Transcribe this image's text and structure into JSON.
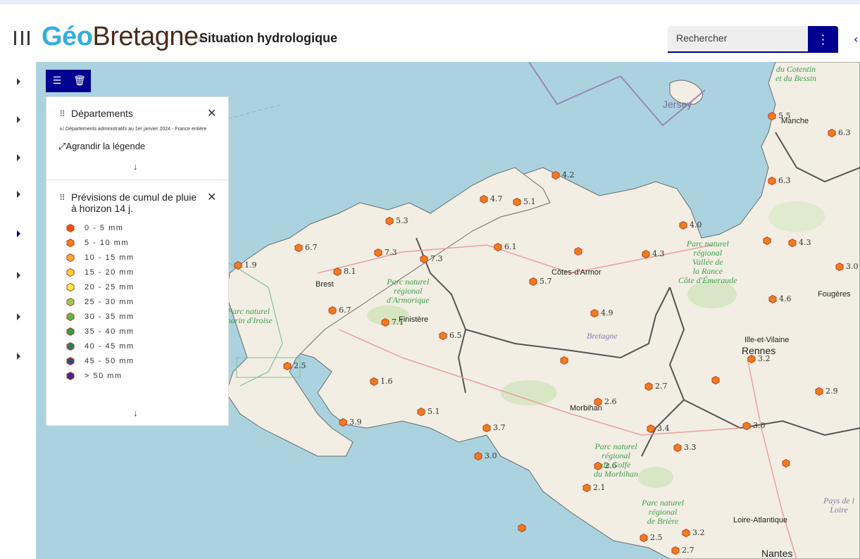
{
  "header": {
    "menu_icon": "hamburger-menu-icon",
    "logo_geo": "Géo",
    "logo_bretagne": "Bretagne",
    "logo_reg": "®",
    "app_title": "Situation hydrologique",
    "search_placeholder": "Rechercher",
    "search_menu_icon": "vertical-dots-icon"
  },
  "toolbar": {
    "legend_icon": "list-icon",
    "delete_icon": "trash-icon"
  },
  "legend": {
    "layer1": {
      "title": "Départements",
      "subtitle": "Départements administratifs au 1er janvier 2024 - France entière",
      "expand_label": "Agrandir la légende"
    },
    "layer2": {
      "title_line1": "Prévisions de cumul de pluie",
      "title_line2": "à horizon 14 j.",
      "classes": [
        {
          "label": "0 - 5 mm",
          "color": "#e8560f"
        },
        {
          "label": "5 - 10  mm",
          "color": "#f07d1a"
        },
        {
          "label": "10 - 15  mm",
          "color": "#f6a833"
        },
        {
          "label": "15 - 20  mm",
          "color": "#fbd33f"
        },
        {
          "label": "20 - 25  mm",
          "color": "#f3f04a"
        },
        {
          "label": "25 - 30  mm",
          "color": "#8fd14f"
        },
        {
          "label": "30 - 35  mm",
          "color": "#57b84b"
        },
        {
          "label": "35 - 40  mm",
          "color": "#2f9e4f"
        },
        {
          "label": "40 - 45  mm",
          "color": "#2d7d5e"
        },
        {
          "label": "45 - 50  mm",
          "color": "#2b4f7d"
        },
        {
          "label": "> 50 mm",
          "color": "#3d2a8c"
        }
      ]
    }
  },
  "map": {
    "places": {
      "jersey": "Jersey",
      "cotentin_line1": "du Cotentin",
      "cotentin_line2": "et du Bessin",
      "manche": "Manche",
      "brest": "Brest",
      "finistere": "Finistère",
      "cotes_darmor": "Côtes-d'Armor",
      "bretagne": "Bretagne",
      "morbihan": "Morbihan",
      "ille_et_vilaine": "Ille-et-Vilaine",
      "rennes": "Rennes",
      "fougeres": "Fougères",
      "loire_atlantique": "Loire-Atlantique",
      "nantes": "Nantes",
      "pays_de_loire_line1": "Pays de l",
      "pays_de_loire_line2": "Loire"
    },
    "parks": {
      "armorique": [
        "Parc naturel",
        "régional",
        "d'Armorique"
      ],
      "iroise": [
        "Parc naturel",
        "marin d'Iroise"
      ],
      "rance": [
        "Parc naturel",
        "régional",
        "Vallée de",
        "la Rance",
        "Côte d'Émeraude"
      ],
      "golfe": [
        "Parc naturel",
        "régional",
        "du Golfe",
        "du Morbihan"
      ],
      "briere": [
        "Parc naturel",
        "régional",
        "de Brière"
      ]
    },
    "stations": [
      {
        "value": "5.5"
      },
      {
        "value": "6.3"
      },
      {
        "value": "6.3"
      },
      {
        "value": "4.2"
      },
      {
        "value": "4.7"
      },
      {
        "value": "5.1"
      },
      {
        "value": "5.3"
      },
      {
        "value": "4.0"
      },
      {
        "value": "6.7"
      },
      {
        "value": "7.3"
      },
      {
        "value": "7.3"
      },
      {
        "value": "6.1"
      },
      {
        "value": "4.3"
      },
      {
        "value": "1.9"
      },
      {
        "value": "8.1"
      },
      {
        "value": "5.7"
      },
      {
        "value": "6.7"
      },
      {
        "value": "7.1"
      },
      {
        "value": "4.9"
      },
      {
        "value": "4.6"
      },
      {
        "value": "6.5"
      },
      {
        "value": "2.5"
      },
      {
        "value": "3.2"
      },
      {
        "value": "1.6"
      },
      {
        "value": "2.7"
      },
      {
        "value": "2.6"
      },
      {
        "value": "5.1"
      },
      {
        "value": "2.9"
      },
      {
        "value": "3.0"
      },
      {
        "value": "3.9"
      },
      {
        "value": "3.7"
      },
      {
        "value": "3.4"
      },
      {
        "value": "3.3"
      },
      {
        "value": "3.0"
      },
      {
        "value": "2.6"
      },
      {
        "value": "2.1"
      },
      {
        "value": "2.5"
      },
      {
        "value": "3.2"
      },
      {
        "value": "2.7"
      },
      {
        "value": "3.0"
      },
      {
        "value": "4.3"
      }
    ]
  }
}
